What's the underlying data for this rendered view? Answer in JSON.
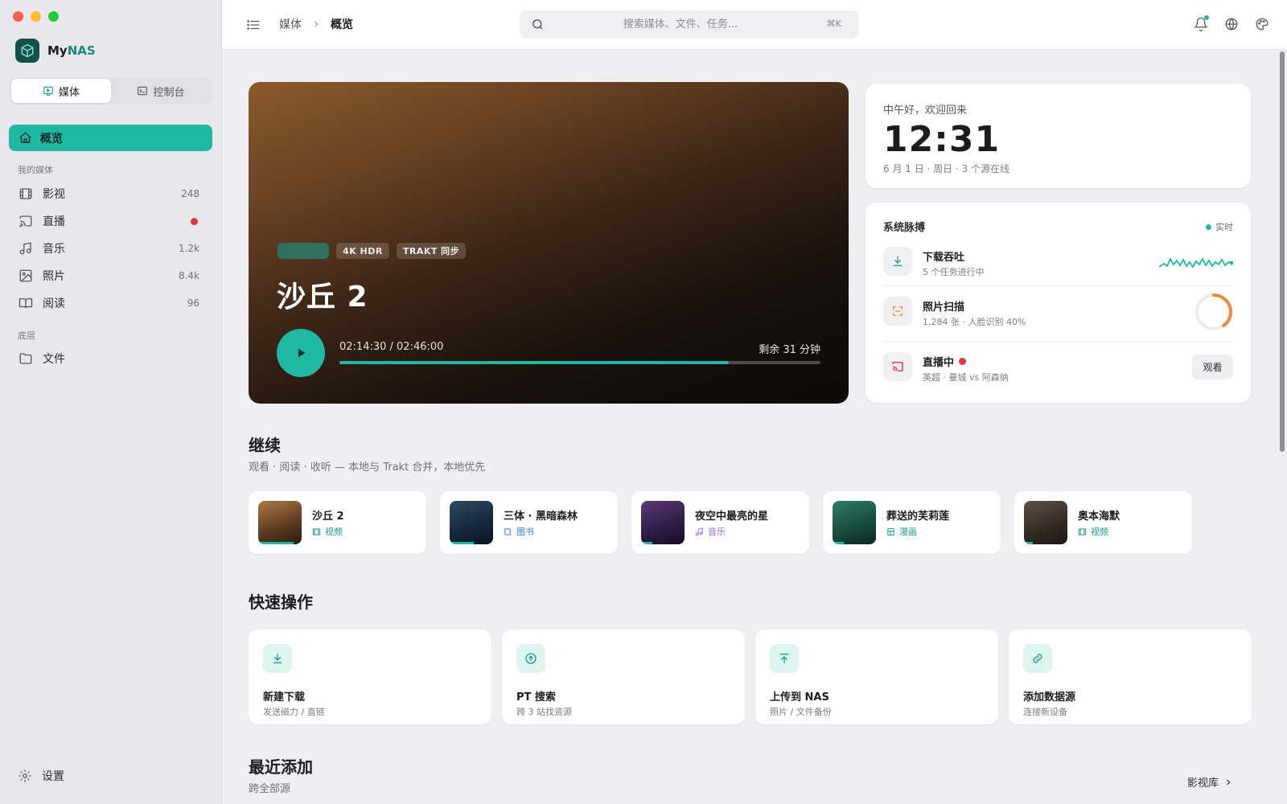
{
  "colors": {
    "accent": "#1fb8a2",
    "live": "#e5333c",
    "orange": "#f08a3c",
    "video": "#1b9a8a",
    "book": "#3b7be0",
    "music": "#a06ae0",
    "comic": "#1b9a8a"
  },
  "sidebar": {
    "brand_prefix": "My",
    "brand_suffix": "NAS",
    "tabs": [
      {
        "label": "媒体",
        "icon": "media-icon",
        "active": true
      },
      {
        "label": "控制台",
        "icon": "terminal-icon",
        "active": false
      }
    ],
    "active_item": {
      "label": "概览",
      "icon": "home-icon"
    },
    "section_media": "我的媒体",
    "media_items": [
      {
        "label": "影视",
        "icon": "film-icon",
        "count": "248"
      },
      {
        "label": "直播",
        "icon": "cast-icon",
        "count": ""
      },
      {
        "label": "音乐",
        "icon": "music-icon",
        "count": "1.2k"
      },
      {
        "label": "照片",
        "icon": "photo-icon",
        "count": "8.4k"
      },
      {
        "label": "阅读",
        "icon": "book-icon",
        "count": "96"
      }
    ],
    "section_base": "底层",
    "base_items": [
      {
        "label": "文件",
        "icon": "folder-icon"
      }
    ],
    "settings_label": "设置"
  },
  "topbar": {
    "breadcrumb_root": "媒体",
    "breadcrumb_current": "概览",
    "search_placeholder": "搜索媒体、文件、任务...",
    "search_shortcut": "⌘K"
  },
  "hero": {
    "tags": [
      "4K HDR",
      "TRAKT 同步"
    ],
    "title": "沙丘 2",
    "time": "02:14:30 / 02:46:00",
    "remaining": "剩余 31 分钟",
    "progress": 0.81
  },
  "greeting": {
    "text": "中午好，欢迎回来",
    "clock": "12:31",
    "sub": "6 月 1 日 · 周日 · 3 个源在线"
  },
  "pulse": {
    "title": "系统脉搏",
    "live_label": "实时",
    "download": {
      "name": "下载吞吐",
      "desc": "5 个任务进行中"
    },
    "scan": {
      "name": "照片扫描",
      "desc": "1,284 张 · 人脸识别 40%",
      "progress": 0.4
    },
    "live": {
      "name": "直播中",
      "desc": "英超 · 曼城 vs 阿森纳",
      "button": "观看"
    }
  },
  "continue_section": {
    "title": "继续",
    "sub": "观看 · 阅读 · 收听 — 本地与 Trakt 合并，本地优先",
    "items": [
      {
        "title": "沙丘 2",
        "type": "视频",
        "icon": "film-icon",
        "progress": 0.81
      },
      {
        "title": "三体 · 黑暗森林",
        "type": "图书",
        "icon": "book-icon",
        "progress": 0.55
      },
      {
        "title": "夜空中最亮的星",
        "type": "音乐",
        "icon": "music-icon",
        "progress": 0.25
      },
      {
        "title": "葬送的芙莉莲",
        "type": "漫画",
        "icon": "comic-icon",
        "progress": 0.25
      },
      {
        "title": "奥本海默",
        "type": "视频",
        "icon": "film-icon",
        "progress": 0.2
      }
    ]
  },
  "quick_section": {
    "title": "快速操作",
    "items": [
      {
        "title": "新建下载",
        "sub": "发送磁力 / 直链",
        "icon": "download-icon"
      },
      {
        "title": "PT 搜索",
        "sub": "跨 3 站找资源",
        "icon": "pt-search-icon"
      },
      {
        "title": "上传到 NAS",
        "sub": "照片 / 文件备份",
        "icon": "upload-icon"
      },
      {
        "title": "添加数据源",
        "sub": "连接新设备",
        "icon": "link-icon"
      }
    ]
  },
  "recent_section": {
    "title": "最近添加",
    "sub": "跨全部源",
    "link": "影视库"
  }
}
